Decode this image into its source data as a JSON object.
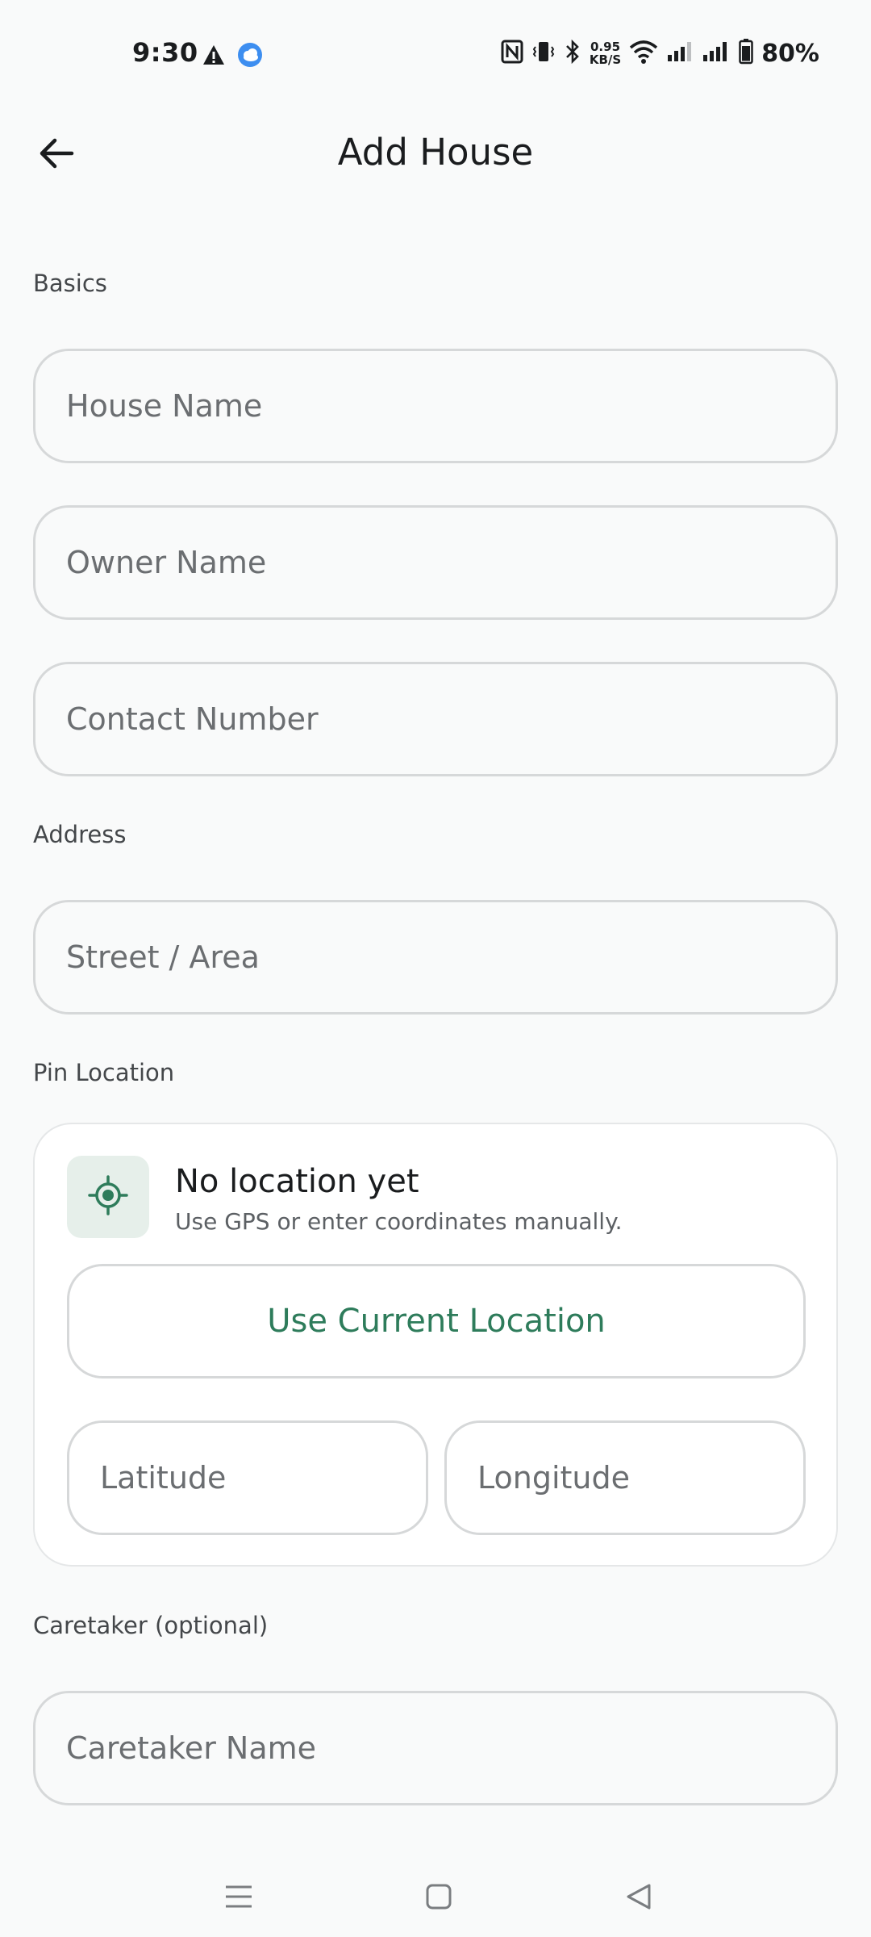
{
  "status_bar": {
    "time": "9:30",
    "speed_value": "0.95",
    "speed_unit": "KB/S",
    "battery": "80%",
    "icons": [
      "alert-icon",
      "weather-icon",
      "nfc-icon",
      "vibrate-icon",
      "bluetooth-icon",
      "wifi-icon",
      "signal-icon",
      "battery-icon"
    ]
  },
  "app_bar": {
    "title": "Add House",
    "back_icon": "arrow-left-icon"
  },
  "sections": {
    "basics": "Basics",
    "address": "Address",
    "pin_location": "Pin Location",
    "caretaker": "Caretaker (optional)"
  },
  "fields": {
    "house_name": "House Name",
    "owner_name": "Owner Name",
    "contact_number": "Contact Number",
    "street_area": "Street / Area",
    "latitude": "Latitude",
    "longitude": "Longitude",
    "caretaker_name": "Caretaker Name"
  },
  "location_card": {
    "icon": "gps-target-icon",
    "title": "No location yet",
    "subtitle": "Use GPS or enter coordinates manually.",
    "button": "Use Current Location"
  },
  "nav_bar": {
    "icons": [
      "menu-icon",
      "home-icon",
      "back-icon"
    ]
  },
  "colors": {
    "accent": "#2e7c5b",
    "background": "#f9fafa",
    "border": "#d6d8d9",
    "icon_box": "#e6efea"
  }
}
